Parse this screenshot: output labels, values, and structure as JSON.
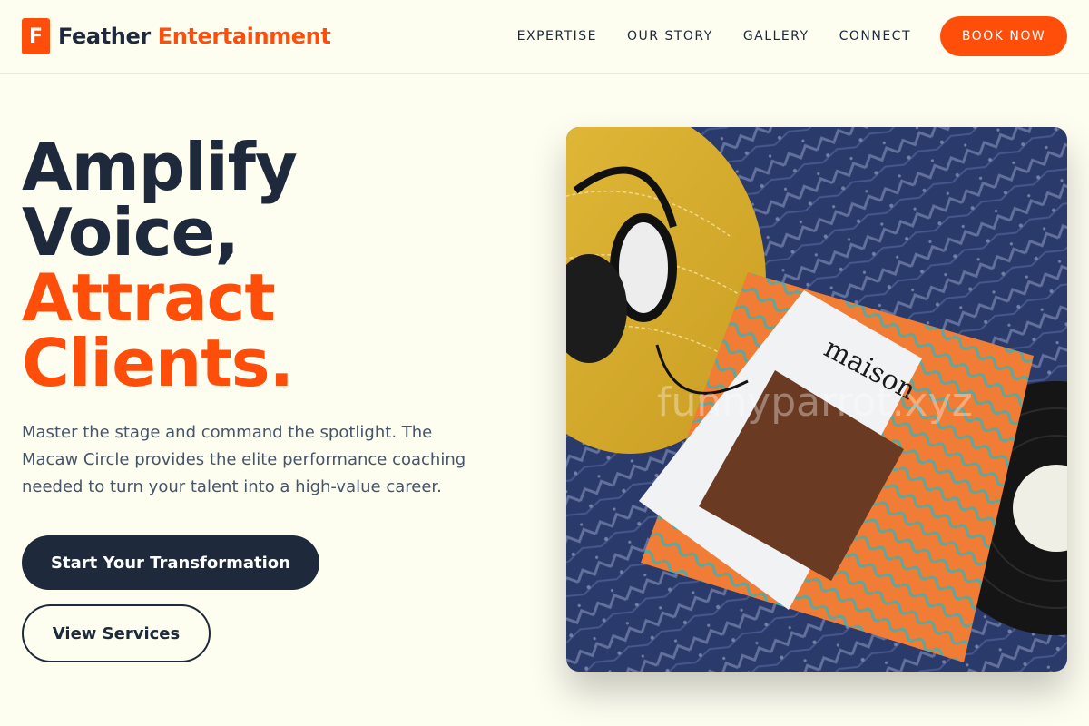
{
  "brand": {
    "logo_letter": "F",
    "name_part1": "Feather",
    "name_part2": "Entertainment"
  },
  "nav": {
    "items": [
      "EXPERTISE",
      "OUR STORY",
      "GALLERY",
      "CONNECT"
    ],
    "cta": "BOOK NOW"
  },
  "hero": {
    "title_line1": "Amplify",
    "title_line2": "Voice,",
    "title_line3": "Attract",
    "title_line4": "Clients.",
    "subtitle": "Master the stage and command the spotlight. The Macaw Circle provides the elite performance coaching needed to turn your talent into a high-value career.",
    "primary_cta": "Start Your Transformation",
    "secondary_cta": "View Services",
    "image_text": {
      "magazine_title": "maison",
      "watermark": "funnyparrot.xyz"
    }
  },
  "colors": {
    "accent": "#ff4d0a",
    "dark": "#1e293b",
    "background": "#fdfdf0",
    "body_text": "#475569"
  }
}
